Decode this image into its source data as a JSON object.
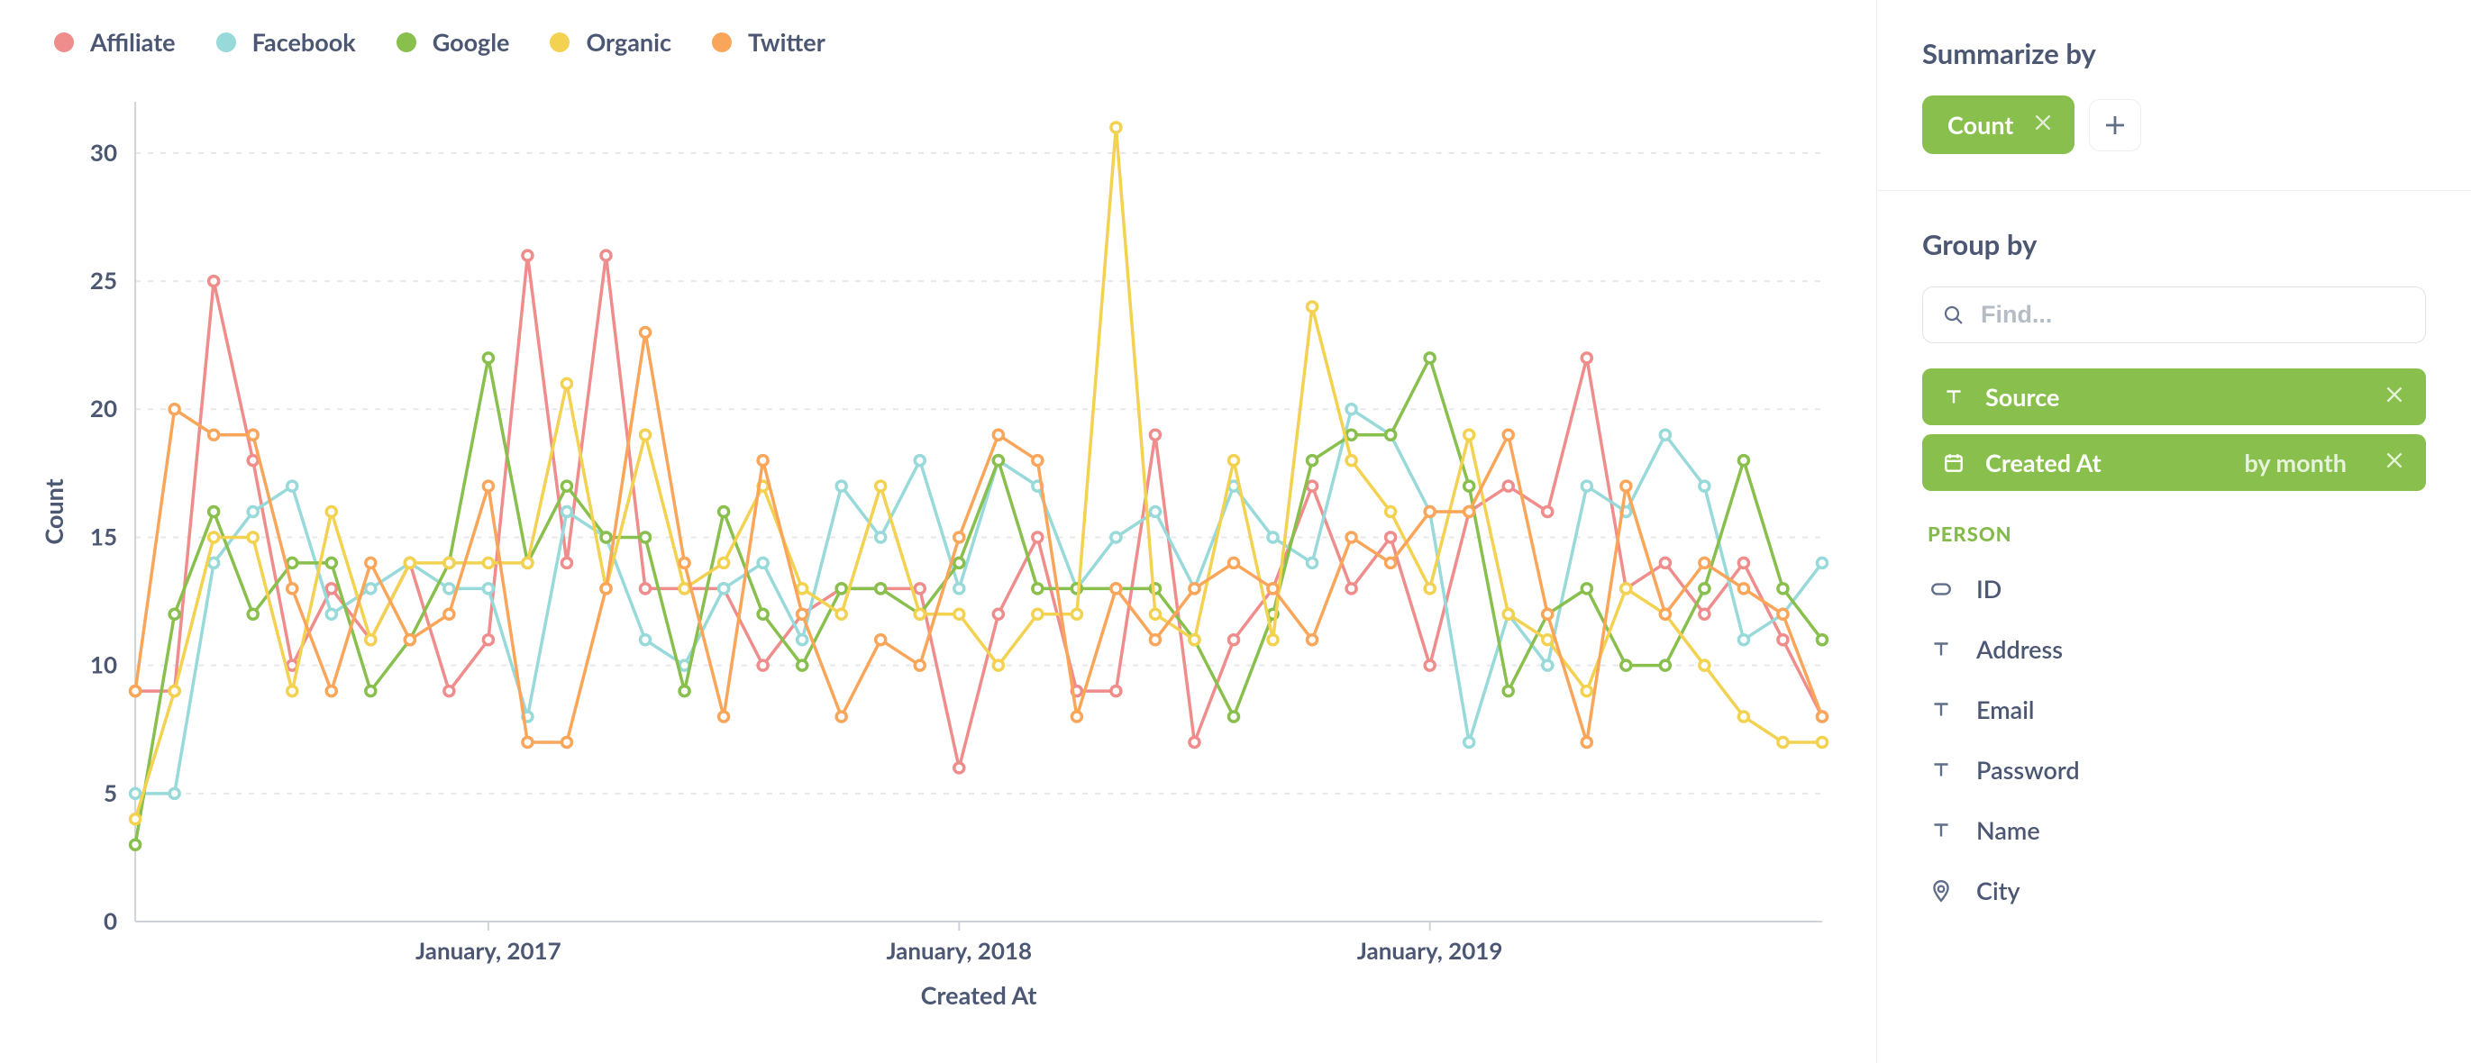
{
  "legend": [
    {
      "label": "Affiliate",
      "color": "#ef8c8c"
    },
    {
      "label": "Facebook",
      "color": "#98d9d9"
    },
    {
      "label": "Google",
      "color": "#88bf4d"
    },
    {
      "label": "Organic",
      "color": "#f2d250"
    },
    {
      "label": "Twitter",
      "color": "#f9a65a"
    }
  ],
  "side": {
    "summarize_title": "Summarize by",
    "summarize_chip": "Count",
    "groupby_title": "Group by",
    "search_placeholder": "Find...",
    "group_source": "Source",
    "group_created": "Created At",
    "group_created_sub": "by month",
    "cat_person": "PERSON",
    "fields": {
      "id": "ID",
      "address": "Address",
      "email": "Email",
      "password": "Password",
      "name": "Name",
      "city": "City"
    }
  },
  "chart_data": {
    "type": "line",
    "xlabel": "Created At",
    "ylabel": "Count",
    "ylim": [
      0,
      32
    ],
    "y_ticks": [
      0,
      5,
      10,
      15,
      20,
      25,
      30
    ],
    "x_tick_labels": [
      "January, 2017",
      "January, 2018",
      "January, 2019"
    ],
    "x_tick_positions": [
      9,
      21,
      33
    ],
    "n_points": 44,
    "series": [
      {
        "name": "Affiliate",
        "color": "#ef8c8c",
        "values": [
          9,
          9,
          25,
          18,
          10,
          13,
          11,
          14,
          9,
          11,
          26,
          14,
          26,
          13,
          13,
          13,
          10,
          12,
          13,
          13,
          13,
          6,
          12,
          15,
          9,
          9,
          19,
          7,
          11,
          13,
          17,
          13,
          15,
          10,
          16,
          17,
          16,
          22,
          13,
          14,
          12,
          14,
          11,
          8
        ]
      },
      {
        "name": "Facebook",
        "color": "#98d9d9",
        "values": [
          5,
          5,
          14,
          16,
          17,
          12,
          13,
          14,
          13,
          13,
          8,
          16,
          15,
          11,
          10,
          13,
          14,
          11,
          17,
          15,
          18,
          13,
          18,
          17,
          13,
          15,
          16,
          13,
          17,
          15,
          14,
          20,
          19,
          16,
          7,
          12,
          10,
          17,
          16,
          19,
          17,
          11,
          12,
          14
        ]
      },
      {
        "name": "Google",
        "color": "#88bf4d",
        "values": [
          3,
          12,
          16,
          12,
          14,
          14,
          9,
          11,
          14,
          22,
          14,
          17,
          15,
          15,
          9,
          16,
          12,
          10,
          13,
          13,
          12,
          14,
          18,
          13,
          13,
          13,
          13,
          11,
          8,
          12,
          18,
          19,
          19,
          22,
          17,
          9,
          12,
          13,
          10,
          10,
          13,
          18,
          13,
          11
        ]
      },
      {
        "name": "Organic",
        "color": "#f2d250",
        "values": [
          4,
          9,
          15,
          15,
          9,
          16,
          11,
          14,
          14,
          14,
          14,
          21,
          13,
          19,
          13,
          14,
          17,
          13,
          12,
          17,
          12,
          12,
          10,
          12,
          12,
          31,
          12,
          11,
          18,
          11,
          24,
          18,
          16,
          13,
          19,
          12,
          11,
          9,
          13,
          12,
          10,
          8,
          7,
          7
        ]
      },
      {
        "name": "Twitter",
        "color": "#f9a65a",
        "values": [
          9,
          20,
          19,
          19,
          13,
          9,
          14,
          11,
          12,
          17,
          7,
          7,
          13,
          23,
          14,
          8,
          18,
          12,
          8,
          11,
          10,
          15,
          19,
          18,
          8,
          13,
          11,
          13,
          14,
          13,
          11,
          15,
          14,
          16,
          16,
          19,
          12,
          7,
          17,
          12,
          14,
          13,
          12,
          8
        ]
      }
    ]
  }
}
